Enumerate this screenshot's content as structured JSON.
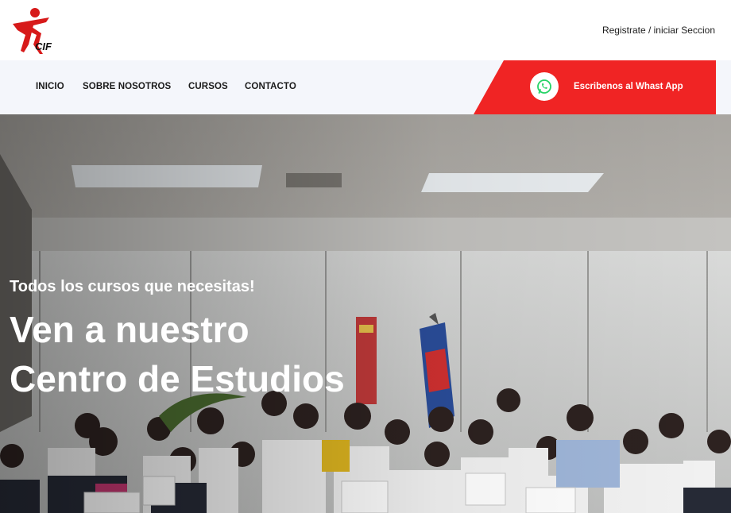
{
  "brand": {
    "logo_text": "CIF",
    "accent": "#f02424"
  },
  "header": {
    "auth_link": "Registrate / iniciar Seccion"
  },
  "nav": {
    "items": [
      {
        "label": "INICIO"
      },
      {
        "label": "SOBRE NOSOTROS"
      },
      {
        "label": "CURSOS"
      },
      {
        "label": "CONTACTO"
      }
    ]
  },
  "whatsapp": {
    "label": "Escribenos al Whast App",
    "icon": "whatsapp-icon",
    "color": "#25d366"
  },
  "hero": {
    "subtitle": "Todos los cursos que necesitas!",
    "title_line1": "Ven a nuestro",
    "title_line2": "Centro de Estudios"
  }
}
